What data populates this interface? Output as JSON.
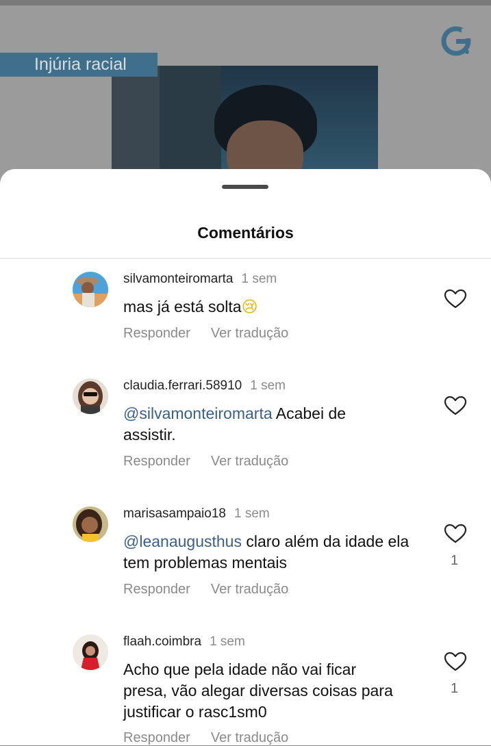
{
  "background_post": {
    "tag": "Injúria racial"
  },
  "sheet": {
    "title": "Comentários"
  },
  "comments": [
    {
      "username": "silvamonteiromarta",
      "time": "1 sem",
      "text": "mas já está  solta",
      "emoji": "😢",
      "reply": "Responder",
      "translate": "Ver tradução",
      "likes": ""
    },
    {
      "username": "claudia.ferrari.58910",
      "time": "1 sem",
      "mention": "@silvamonteiromarta",
      "text": " Acabei de assistir.",
      "reply": "Responder",
      "translate": "Ver tradução",
      "likes": ""
    },
    {
      "username": "marisasampaio18",
      "time": "1 sem",
      "mention": "@leanaugusthus",
      "text": "  claro além da idade ela tem problemas mentais",
      "reply": "Responder",
      "translate": "Ver tradução",
      "likes": "1"
    },
    {
      "username": "flaah.coimbra",
      "time": "1 sem",
      "text": "Acho que pela idade não vai ficar presa, vão alegar diversas coisas para justificar o rasc1sm0",
      "reply": "Responder",
      "translate": "Ver tradução",
      "likes": "1"
    }
  ],
  "colors": {
    "mention": "#3b5f86",
    "tag_bg": "#3f6f8a",
    "logo": "#3f6f8a"
  },
  "icons": {
    "like": "heart-outline-icon",
    "logo": "g-logo-icon"
  }
}
